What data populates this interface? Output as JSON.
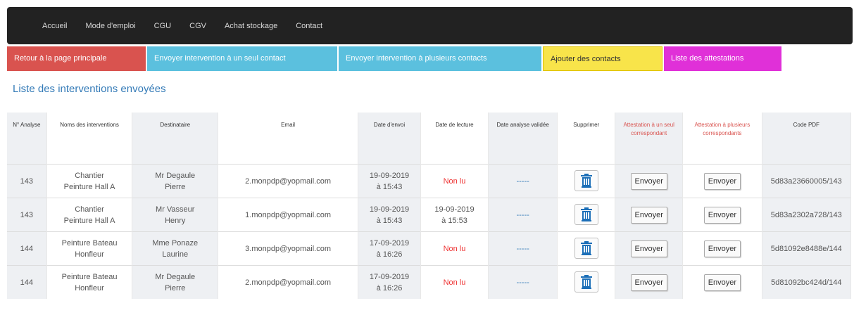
{
  "nav": {
    "items": [
      "Accueil",
      "Mode d'emploi",
      "CGU",
      "CGV",
      "Achat stockage",
      "Contact"
    ]
  },
  "actions": {
    "back": "Retour à la page principale",
    "send_one": "Envoyer intervention à un seul contact",
    "send_many": "Envoyer intervention à plusieurs contacts",
    "add_contacts": "Ajouter des contacts",
    "attestations": "Liste des attestations"
  },
  "page_title": "Liste des interventions envoyées",
  "table": {
    "headers": {
      "analyse": "N° Analyse",
      "noms": "Noms des interventions",
      "dest": "Destinataire",
      "email": "Email",
      "date_envoi": "Date d'envoi",
      "date_lecture": "Date de lecture",
      "date_analyse": "Date analyse validée",
      "supprimer": "Supprimer",
      "att_seul": "Attestation à un seul correspondant",
      "att_plusieurs": "Attestation à plusieurs correspondants",
      "code_pdf": "Code PDF"
    },
    "send_label": "Envoyer",
    "rows": [
      {
        "analyse": "143",
        "nom1": "Chantier",
        "nom2": "Peinture Hall A",
        "dest1": "Mr Degaule",
        "dest2": "Pierre",
        "email": "2.monpdp@yopmail.com",
        "envoi1": "19-09-2019",
        "envoi2": "à 15:43",
        "lecture1": "Non lu",
        "lecture2": "",
        "lecture_unread": true,
        "analyse_valid": "-----",
        "code": "5d83a23660005/143"
      },
      {
        "analyse": "143",
        "nom1": "Chantier",
        "nom2": "Peinture Hall A",
        "dest1": "Mr Vasseur",
        "dest2": "Henry",
        "email": "1.monpdp@yopmail.com",
        "envoi1": "19-09-2019",
        "envoi2": "à 15:43",
        "lecture1": "19-09-2019",
        "lecture2": "à 15:53",
        "lecture_unread": false,
        "analyse_valid": "-----",
        "code": "5d83a2302a728/143"
      },
      {
        "analyse": "144",
        "nom1": "Peinture Bateau",
        "nom2": "Honfleur",
        "dest1": "Mme Ponaze",
        "dest2": "Laurine",
        "email": "3.monpdp@yopmail.com",
        "envoi1": "17-09-2019",
        "envoi2": "à 16:26",
        "lecture1": "Non lu",
        "lecture2": "",
        "lecture_unread": true,
        "analyse_valid": "-----",
        "code": "5d81092e8488e/144"
      },
      {
        "analyse": "144",
        "nom1": "Peinture Bateau",
        "nom2": "Honfleur",
        "dest1": "Mr Degaule",
        "dest2": "Pierre",
        "email": "2.monpdp@yopmail.com",
        "envoi1": "17-09-2019",
        "envoi2": "à 16:26",
        "lecture1": "Non lu",
        "lecture2": "",
        "lecture_unread": true,
        "analyse_valid": "-----",
        "code": "5d81092bc424d/144"
      }
    ]
  },
  "colors": {
    "nav_bg": "#222222",
    "btn_red": "#d9534f",
    "btn_cyan": "#5bc0de",
    "btn_yellow": "#f8e44a",
    "btn_magenta": "#e030d8",
    "title_blue": "#337ab7",
    "unread_red": "#e33333"
  }
}
